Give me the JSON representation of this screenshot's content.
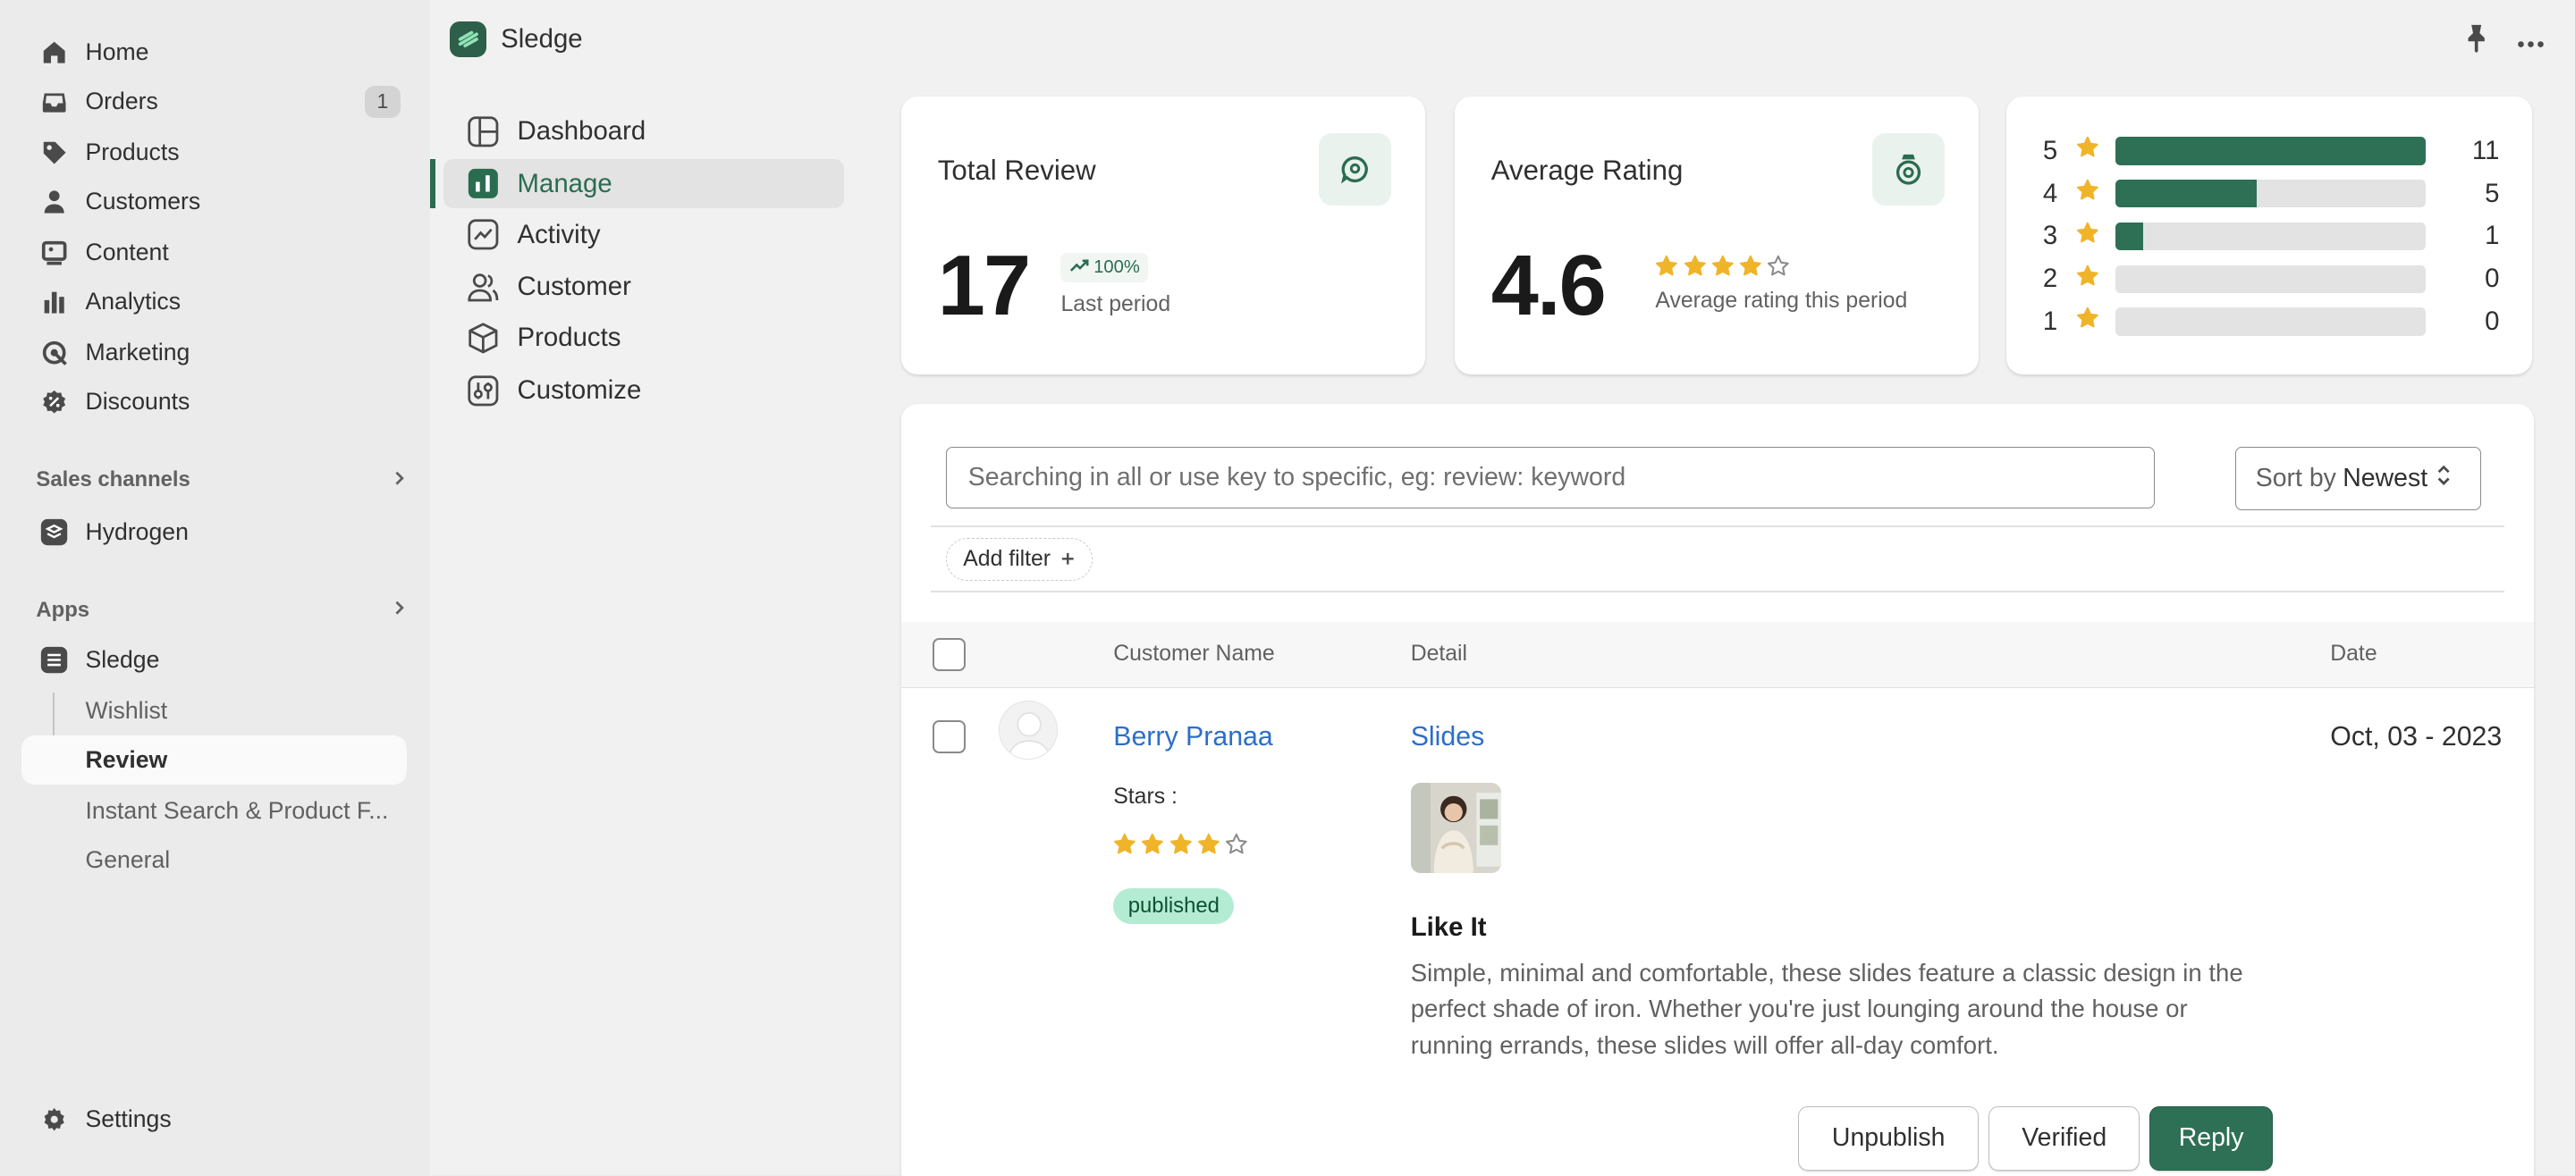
{
  "sidebar": {
    "nav": [
      {
        "label": "Home",
        "icon": "home-icon"
      },
      {
        "label": "Orders",
        "icon": "inbox-icon",
        "count": "1"
      },
      {
        "label": "Products",
        "icon": "tag-icon"
      },
      {
        "label": "Customers",
        "icon": "person-icon"
      },
      {
        "label": "Content",
        "icon": "image-icon"
      },
      {
        "label": "Analytics",
        "icon": "bar-chart-icon"
      },
      {
        "label": "Marketing",
        "icon": "target-icon"
      },
      {
        "label": "Discounts",
        "icon": "discount-icon"
      }
    ],
    "sales_channels_label": "Sales channels",
    "hydrogen_label": "Hydrogen",
    "apps_label": "Apps",
    "sledge_label": "Sledge",
    "sub_items": [
      "Wishlist",
      "Review",
      "Instant Search & Product F...",
      "General"
    ],
    "settings_label": "Settings"
  },
  "topbar": {
    "app_name": "Sledge"
  },
  "subnav": [
    {
      "label": "Dashboard",
      "icon": "dashboard-icon"
    },
    {
      "label": "Manage",
      "icon": "manage-icon"
    },
    {
      "label": "Activity",
      "icon": "activity-icon"
    },
    {
      "label": "Customer",
      "icon": "customers-icon"
    },
    {
      "label": "Products",
      "icon": "box-icon"
    },
    {
      "label": "Customize",
      "icon": "sliders-icon"
    }
  ],
  "stats": {
    "total": {
      "title": "Total Review",
      "value": "17",
      "trend": "100%",
      "sub": "Last period"
    },
    "average": {
      "title": "Average Rating",
      "value": "4.6",
      "rating": 4,
      "sub": "Average rating this period"
    },
    "distribution": [
      {
        "stars": "5",
        "count": "11",
        "fraction": 1.0
      },
      {
        "stars": "4",
        "count": "5",
        "fraction": 0.455
      },
      {
        "stars": "3",
        "count": "1",
        "fraction": 0.09
      },
      {
        "stars": "2",
        "count": "0",
        "fraction": 0
      },
      {
        "stars": "1",
        "count": "0",
        "fraction": 0
      }
    ]
  },
  "toolbar": {
    "search_placeholder": "Searching in all or use key to specific, eg: review: keyword",
    "sort_prefix": "Sort by",
    "sort_value": "Newest",
    "add_filter": "Add filter"
  },
  "table": {
    "headers": {
      "name": "Customer Name",
      "detail": "Detail",
      "date": "Date"
    },
    "row": {
      "customer": "Berry Pranaa",
      "stars_label": "Stars :",
      "rating": 4,
      "status": "published",
      "product": "Slides",
      "review_title": "Like It",
      "review_body": "Simple, minimal and comfortable, these slides feature a classic design in the perfect shade of iron. Whether you're just lounging around the house or running errands, these slides will offer all-day comfort.",
      "date": "Oct, 03 - 2023"
    }
  },
  "actions": {
    "unpublish": "Unpublish",
    "verified": "Verified",
    "reply": "Reply"
  },
  "colors": {
    "brand": "#2e7055",
    "star": "#f0b429",
    "link": "#2c6ecb",
    "published_bg": "#b4ecd3"
  }
}
